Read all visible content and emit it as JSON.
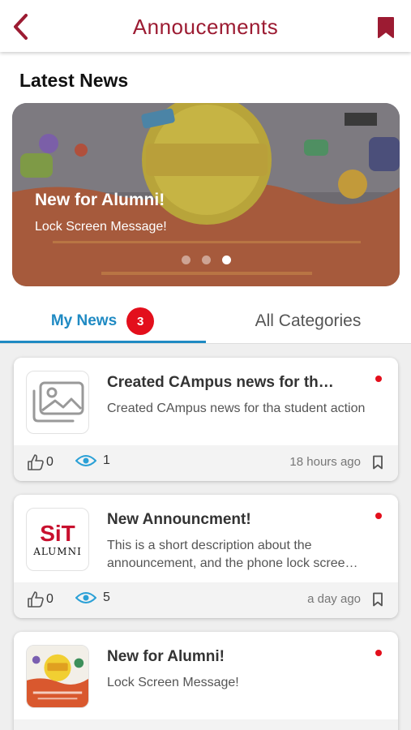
{
  "header": {
    "title": "Annoucements",
    "back_icon": "chevron-left-icon",
    "bookmark_icon": "bookmark-filled-icon",
    "accent": "#9c1b32"
  },
  "latest": {
    "section_title": "Latest News",
    "banner": {
      "headline": "New for Alumni!",
      "subtitle": "Lock Screen Message!",
      "dots": 3,
      "active_dot": 3
    }
  },
  "tabs": {
    "items": [
      {
        "label": "My News",
        "badge": "3",
        "active": true
      },
      {
        "label": "All Categories",
        "active": false
      }
    ],
    "active_color": "#1f8ac3",
    "badge_color": "#e30f1c"
  },
  "news": [
    {
      "title": "Created CAmpus news for th…",
      "desc": "Created CAmpus news for tha student action",
      "thumb": "image-placeholder-icon",
      "likes": "0",
      "views": "1",
      "time": "18 hours ago",
      "unread": true
    },
    {
      "title": "New Announcment!",
      "desc": "This is a short description about the announcement, and the phone lock scree…",
      "thumb_logo": {
        "line1": "SiT",
        "line2": "ALUMNI"
      },
      "likes": "0",
      "views": "5",
      "time": "a day ago",
      "unread": true
    },
    {
      "title": "New for Alumni!",
      "desc": "Lock Screen Message!",
      "thumb": "sticker-patch-poster",
      "unread": true
    }
  ]
}
